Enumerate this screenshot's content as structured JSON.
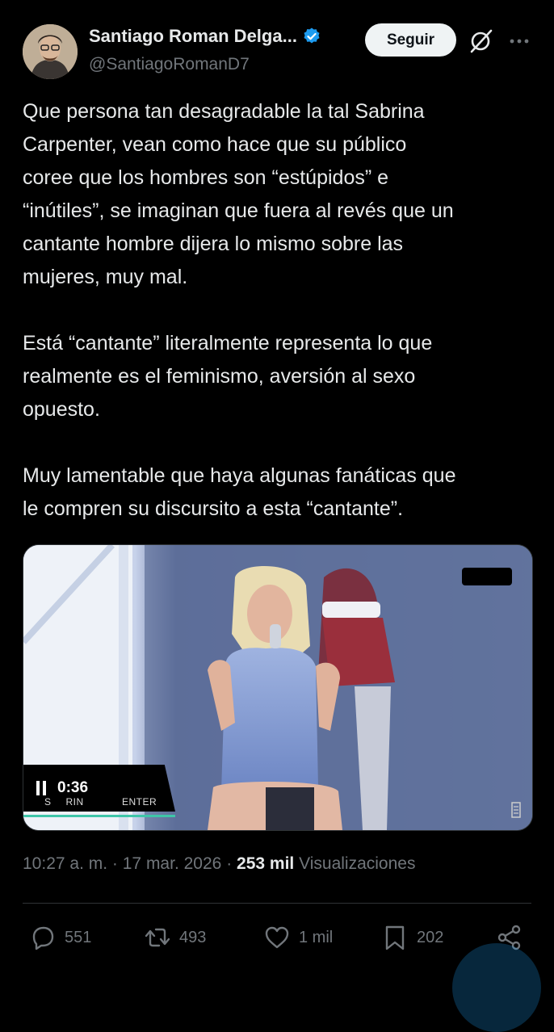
{
  "author": {
    "name": "Santiago Roman Delga...",
    "handle": "@SantiagoRomanD7",
    "follow_label": "Seguir",
    "verified_icon": "verified-badge-icon",
    "colors": {
      "verified": "#1d9bf0"
    }
  },
  "tweet": {
    "paragraphs": [
      [
        "Que persona tan desagradable la tal Sabrina",
        "Carpenter, vean como hace que su público",
        "coree que los hombres son “estúpidos” e",
        "“inútiles”, se imaginan que fuera al revés que un",
        "cantante hombre dijera lo mismo sobre las",
        "mujeres, muy mal."
      ],
      [
        "Está “cantante” literalmente representa lo que",
        "realmente es el feminismo, aversión al sexo",
        "opuesto."
      ],
      [
        "Muy lamentable que haya algunas fanáticas que",
        "le compren su discursito a esta “cantante”."
      ]
    ]
  },
  "media": {
    "video_time": "0:36",
    "overlay_left": "S",
    "overlay_text": "ENTER",
    "overlay_mid": "RIN",
    "colors": {
      "progress": "#3ec6a8"
    }
  },
  "meta": {
    "time": "10:27 a. m.",
    "separator": "·",
    "date": "17 mar. 2026",
    "views_count": "253 mil",
    "views_label": "Visualizaciones"
  },
  "actions": {
    "replies": "551",
    "reposts": "493",
    "likes": "1 mil",
    "bookmarks": "202"
  }
}
